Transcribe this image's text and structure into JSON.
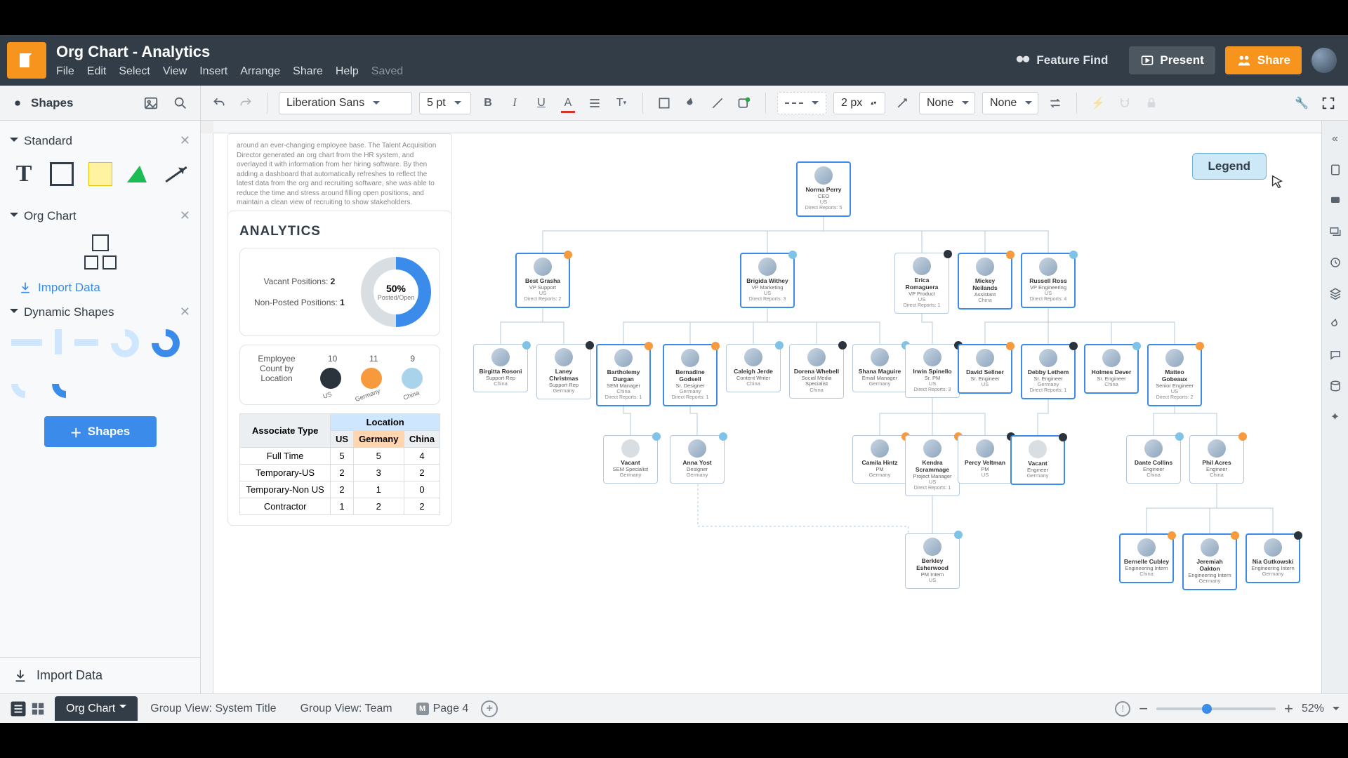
{
  "doc_title": "Org Chart - Analytics",
  "menus": {
    "file": "File",
    "edit": "Edit",
    "select": "Select",
    "view": "View",
    "insert": "Insert",
    "arrange": "Arrange",
    "share": "Share",
    "help": "Help",
    "saved": "Saved"
  },
  "header": {
    "feature_find": "Feature Find",
    "present": "Present",
    "share": "Share"
  },
  "sidebar": {
    "shapes_label": "Shapes",
    "standard": "Standard",
    "org_chart": "Org Chart",
    "import_data": "Import Data",
    "dynamic": "Dynamic Shapes",
    "shapes_button": "Shapes",
    "footer_import": "Import Data"
  },
  "toolbar": {
    "font": "Liberation Sans",
    "size": "5 pt",
    "stroke_width": "2 px",
    "drop_none": "None"
  },
  "legend": "Legend",
  "notecard": "around an ever-changing employee base. The Talent Acquisition Director generated an org chart from the HR system, and overlayed it with information from her hiring software. By then adding a dashboard that automatically refreshes to reflect the latest data from the org and recruiting software, she was able to reduce the time and stress around filling open positions, and maintain a clean view of recruiting to show stakeholders.",
  "analytics": {
    "title": "ANALYTICS",
    "vacant_label": "Vacant Positions:",
    "vacant_value": "2",
    "nonposted_label": "Non-Posted Positions:",
    "nonposted_value": "1",
    "donut_value": "50%",
    "donut_sub": "Posted/Open",
    "count_label": "Employee Count by Location",
    "counts": {
      "us": "10",
      "germany": "11",
      "china": "9"
    },
    "loc_labels": {
      "us": "US",
      "germany": "Germany",
      "china": "China"
    }
  },
  "loc_table": {
    "assoc_hdr": "Associate Type",
    "loc_hdr": "Location",
    "cols": [
      "US",
      "Germany",
      "China"
    ],
    "rows": [
      {
        "label": "Full Time",
        "vals": [
          "5",
          "5",
          "4"
        ]
      },
      {
        "label": "Temporary-US",
        "vals": [
          "2",
          "3",
          "2"
        ]
      },
      {
        "label": "Temporary-Non US",
        "vals": [
          "2",
          "1",
          "0"
        ]
      },
      {
        "label": "Contractor",
        "vals": [
          "1",
          "2",
          "2"
        ]
      }
    ]
  },
  "footer": {
    "tab_main": "Org Chart",
    "tab_g1": "Group View: System Title",
    "tab_g2": "Group View: Team",
    "tab_p4": "Page 4",
    "zoom": "52%"
  },
  "people": {
    "ceo": {
      "nm": "Norma Perry",
      "rl": "CEO",
      "loc": "US",
      "dr": "Direct Reports: 5"
    },
    "r1": [
      {
        "nm": "Best Grasha",
        "rl": "VP Support",
        "loc": "US",
        "dr": "Direct Reports: 2",
        "st": "s-orange"
      },
      {
        "nm": "Brigida Withey",
        "rl": "VP Marketing",
        "loc": "US",
        "dr": "Direct Reports: 3",
        "st": "s-blue"
      },
      {
        "nm": "Erica Romaguera",
        "rl": "VP Product",
        "loc": "US",
        "dr": "Direct Reports: 1",
        "st": "s-dark"
      },
      {
        "nm": "Mickey Neilands",
        "rl": "Assistant",
        "loc": "China",
        "dr": "",
        "st": "s-orange"
      },
      {
        "nm": "Russell Ross",
        "rl": "VP Engineering",
        "loc": "US",
        "dr": "Direct Reports: 4",
        "st": "s-blue"
      }
    ],
    "r2": [
      {
        "nm": "Birgitta Rosoni",
        "rl": "Support Rep",
        "loc": "China",
        "st": "s-blue"
      },
      {
        "nm": "Laney Christmas",
        "rl": "Support Rep",
        "loc": "Germany",
        "st": "s-dark"
      },
      {
        "nm": "Bartholemy Durgan",
        "rl": "SEM Manager",
        "loc": "China",
        "dr": "Direct Reports: 1",
        "st": "s-orange"
      },
      {
        "nm": "Bernadine Godsell",
        "rl": "Sr. Designer",
        "loc": "Germany",
        "dr": "Direct Reports: 1",
        "st": "s-orange"
      },
      {
        "nm": "Caleigh Jerde",
        "rl": "Content Writer",
        "loc": "China",
        "st": "s-blue"
      },
      {
        "nm": "Dorena Whebell",
        "rl": "Social Media Specialist",
        "loc": "China",
        "st": "s-dark"
      },
      {
        "nm": "Shana Maguire",
        "rl": "Email Manager",
        "loc": "Germany",
        "st": "s-blue"
      },
      {
        "nm": "Irwin Spinello",
        "rl": "Sr. PM",
        "loc": "US",
        "dr": "Direct Reports: 3",
        "st": "s-dark"
      },
      {
        "nm": "David Sellner",
        "rl": "Sr. Engineer",
        "loc": "US",
        "st": "s-orange"
      },
      {
        "nm": "Debby Lethem",
        "rl": "Sr. Engineer",
        "loc": "Germany",
        "dr": "Direct Reports: 1",
        "st": "s-dark"
      },
      {
        "nm": "Holmes Dever",
        "rl": "Sr. Engineer",
        "loc": "China",
        "st": "s-blue"
      },
      {
        "nm": "Matteo Gobeaux",
        "rl": "Senior Engineer",
        "loc": "US",
        "dr": "Direct Reports: 2",
        "st": "s-orange"
      }
    ],
    "r3": [
      {
        "nm": "Vacant",
        "rl": "SEM Specialist",
        "loc": "Germany",
        "vac": true,
        "st": "s-blue"
      },
      {
        "nm": "Anna Yost",
        "rl": "Designer",
        "loc": "Germany",
        "st": "s-blue"
      },
      {
        "nm": "Camila Hintz",
        "rl": "PM",
        "loc": "Germany",
        "st": "s-orange"
      },
      {
        "nm": "Kendra Scrammage",
        "rl": "Project Manager",
        "loc": "US",
        "dr": "Direct Reports: 1",
        "st": "s-orange"
      },
      {
        "nm": "Percy Veltman",
        "rl": "PM",
        "loc": "US",
        "st": "s-dark"
      },
      {
        "nm": "Vacant",
        "rl": "Engineer",
        "loc": "Germany",
        "vac": true,
        "st": "s-dark"
      },
      {
        "nm": "Dante Collins",
        "rl": "Engineer",
        "loc": "China",
        "st": "s-blue"
      },
      {
        "nm": "Phil Acres",
        "rl": "Engineer",
        "loc": "China",
        "st": "s-orange"
      }
    ],
    "r4": [
      {
        "nm": "Berkley Esherwood",
        "rl": "PM Intern",
        "loc": "US",
        "st": "s-blue"
      },
      {
        "nm": "Bernelle Cubley",
        "rl": "Engineering Intern",
        "loc": "China",
        "st": "s-orange"
      },
      {
        "nm": "Jeremiah Oakton",
        "rl": "Engineering Intern",
        "loc": "Germany",
        "st": "s-orange"
      },
      {
        "nm": "Nia Gutkowski",
        "rl": "Engineering Intern",
        "loc": "Germany",
        "st": "s-dark"
      }
    ]
  },
  "chart_data": {
    "type": "table",
    "title": "Employee Count by Location / Associate Type",
    "series": [
      {
        "name": "Employee Count by Location",
        "categories": [
          "US",
          "Germany",
          "China"
        ],
        "values": [
          10,
          11,
          9
        ]
      }
    ],
    "matrix": {
      "cols": [
        "US",
        "Germany",
        "China"
      ],
      "rows": [
        "Full Time",
        "Temporary-US",
        "Temporary-Non US",
        "Contractor"
      ],
      "values": [
        [
          5,
          5,
          4
        ],
        [
          2,
          3,
          2
        ],
        [
          2,
          1,
          0
        ],
        [
          1,
          2,
          2
        ]
      ]
    },
    "donut": {
      "label": "Posted/Open",
      "percent": 50
    }
  }
}
